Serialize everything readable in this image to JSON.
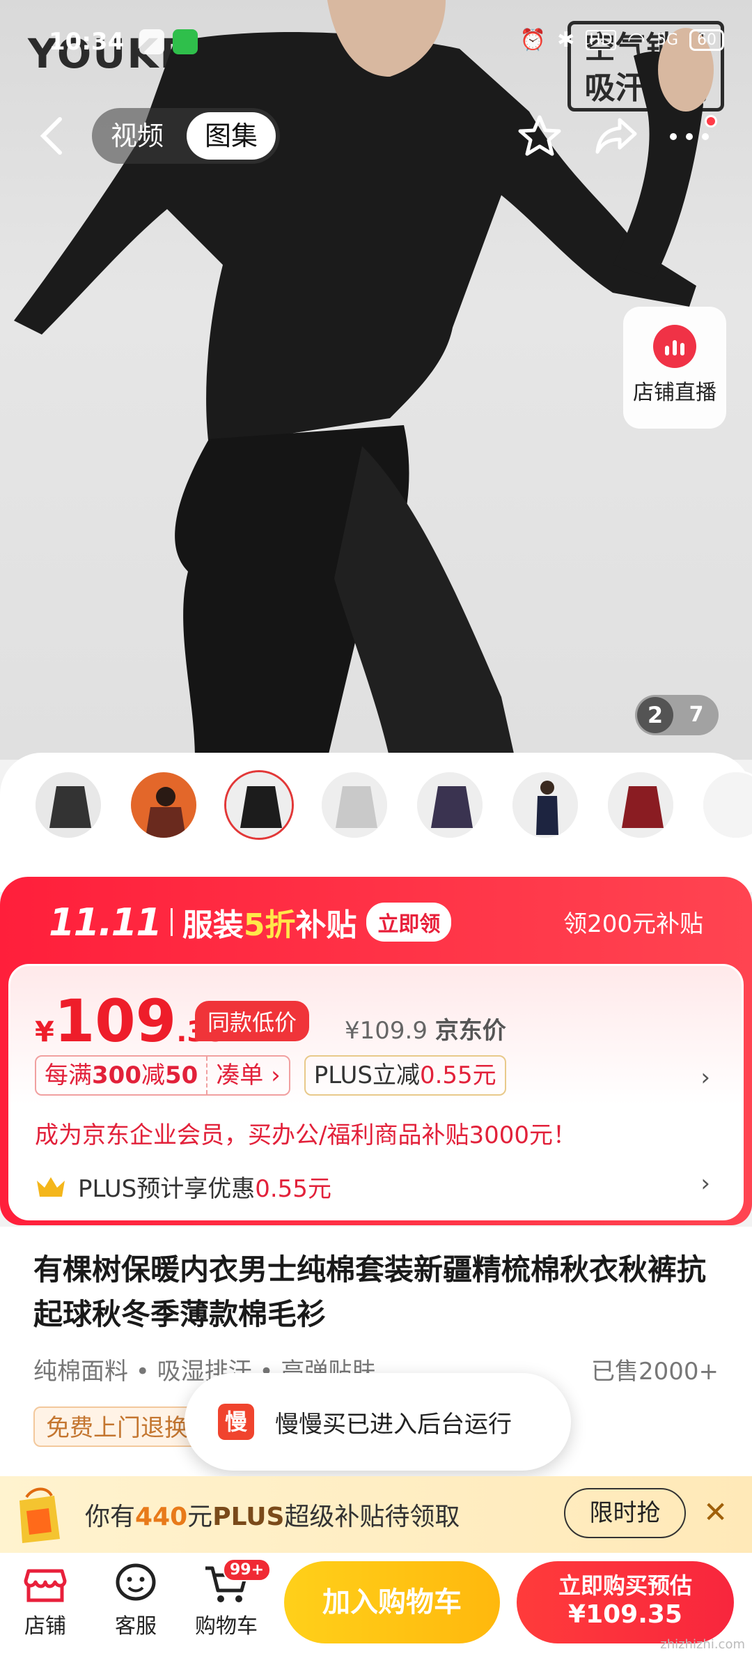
{
  "status": {
    "time": "10:34",
    "battery": "60",
    "network": "5G"
  },
  "hero": {
    "brand": "YOUKESHU 有棵树",
    "tag_line1": "空气锁温",
    "tag_line2": "吸汗透气",
    "live_label": "店铺直播",
    "page_current": "2",
    "page_total": "7"
  },
  "nav": {
    "video": "视频",
    "gallery": "图集"
  },
  "promo": {
    "logo": "11.11",
    "headline_a": "服装",
    "headline_b": "5折",
    "headline_c": "补贴",
    "claim": "立即领",
    "sub": "领200元补贴"
  },
  "price": {
    "currency": "¥",
    "int": "109",
    "dec": ".35",
    "badge": "同款低价",
    "jd_price": "¥109.9",
    "jd_label": "京东价"
  },
  "coupons": {
    "c1_a": "每满",
    "c1_b": "300",
    "c1_c": "减",
    "c1_d": "50",
    "c1_action": "凑单 ›",
    "plus_a": "PLUS立减",
    "plus_b": "0.55元"
  },
  "enterprise": "成为京东企业会员，买办公/福利商品补贴3000元！",
  "plus_row": {
    "a": "PLUS预计享优惠",
    "b": "0.55元"
  },
  "product": {
    "title": "有棵树保暖内衣男士纯棉套装新疆精梳棉秋衣秋裤抗起球秋冬季薄款棉毛衫",
    "features": "纯棉面料 • 吸湿排汗 • 高弹贴肤",
    "sold": "已售2000+",
    "free_return": "免费上门退换"
  },
  "toast": {
    "icon": "慢",
    "message": "慢慢买已进入后台运行"
  },
  "plus_banner": {
    "a": "你有",
    "b": "440",
    "c": "元",
    "d": "PLUS",
    "e": "超级补贴待领取",
    "btn": "限时抢",
    "close": "✕"
  },
  "bottom": {
    "store": "店铺",
    "service": "客服",
    "cart": "购物车",
    "cart_badge": "99+",
    "add_cart": "加入购物车",
    "buy_a": "立即购买预估",
    "buy_b": "¥109.35"
  },
  "watermark": "zhizhizhi.com",
  "colors": {
    "accent_red": "#ff1f3b",
    "price_red": "#ee1d2a",
    "yellow": "#ffc412"
  }
}
